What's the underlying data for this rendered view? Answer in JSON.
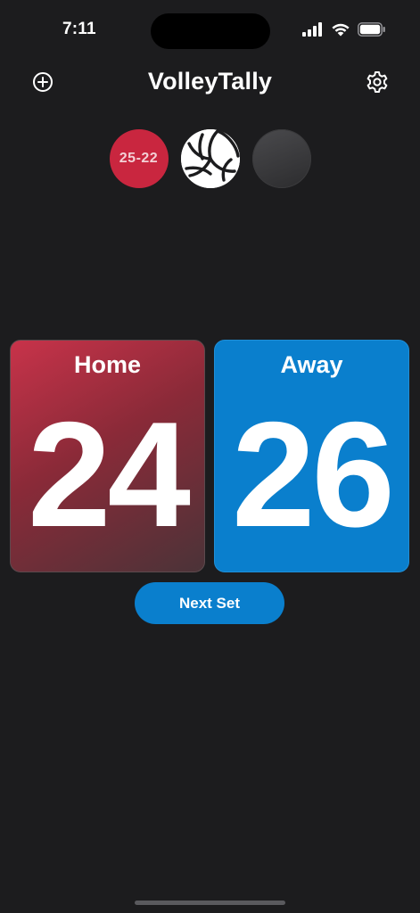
{
  "status_bar": {
    "time": "7:11",
    "icons": [
      "cellular-signal-icon",
      "wifi-icon",
      "battery-icon"
    ]
  },
  "header": {
    "title": "VolleyTally",
    "left_icon": "add-circle-icon",
    "right_icon": "gear-icon"
  },
  "set_history": [
    {
      "label": "25-22",
      "state": "completed",
      "color": "#c9263f"
    },
    {
      "label": "",
      "state": "current",
      "icon": "volleyball-icon"
    },
    {
      "label": "",
      "state": "upcoming"
    }
  ],
  "scoreboard": {
    "home": {
      "name": "Home",
      "score": "24",
      "color": "#c8334a"
    },
    "away": {
      "name": "Away",
      "score": "26",
      "color": "#0a7fcd"
    }
  },
  "actions": {
    "next_set_label": "Next Set"
  },
  "colors": {
    "background": "#1c1c1e",
    "accent_blue": "#0a7fcd",
    "accent_red": "#c9263f"
  }
}
